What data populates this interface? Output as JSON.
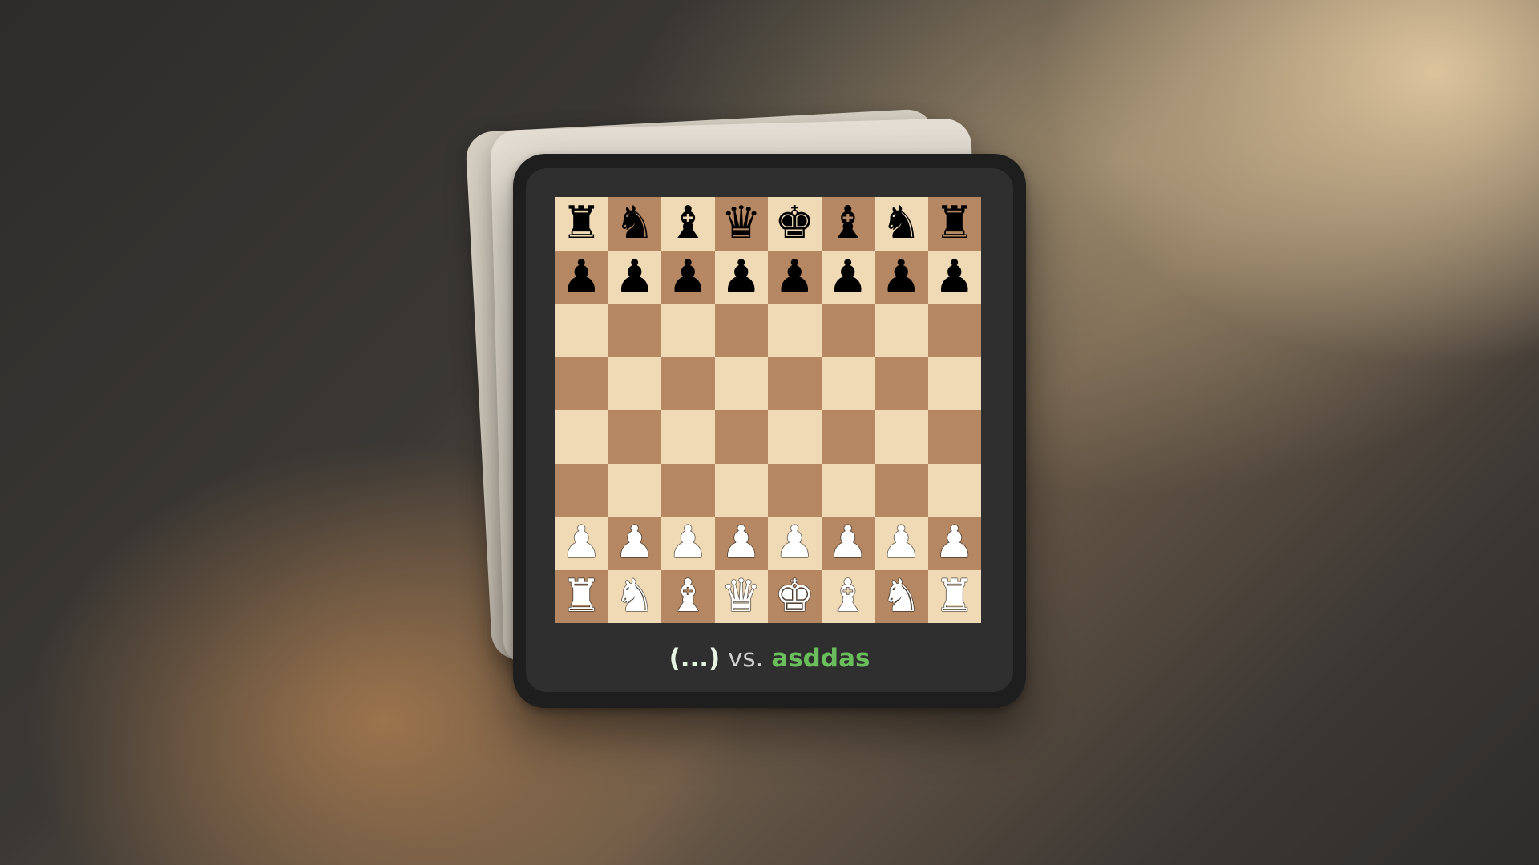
{
  "game": {
    "player_one": "(...)",
    "versus": "vs.",
    "player_two": "asddas"
  },
  "board": {
    "light_color": "#f0d9b5",
    "dark_color": "#b58863",
    "ranks": [
      [
        "♜",
        "♞",
        "♝",
        "♛",
        "♚",
        "♝",
        "♞",
        "♜"
      ],
      [
        "♟",
        "♟",
        "♟",
        "♟",
        "♟",
        "♟",
        "♟",
        "♟"
      ],
      [
        "",
        "",
        "",
        "",
        "",
        "",
        "",
        ""
      ],
      [
        "",
        "",
        "",
        "",
        "",
        "",
        "",
        ""
      ],
      [
        "",
        "",
        "",
        "",
        "",
        "",
        "",
        ""
      ],
      [
        "",
        "",
        "",
        "",
        "",
        "",
        "",
        ""
      ],
      [
        "♙",
        "♙",
        "♙",
        "♙",
        "♙",
        "♙",
        "♙",
        "♙"
      ],
      [
        "♖",
        "♘",
        "♗",
        "♕",
        "♔",
        "♗",
        "♘",
        "♖"
      ]
    ]
  }
}
